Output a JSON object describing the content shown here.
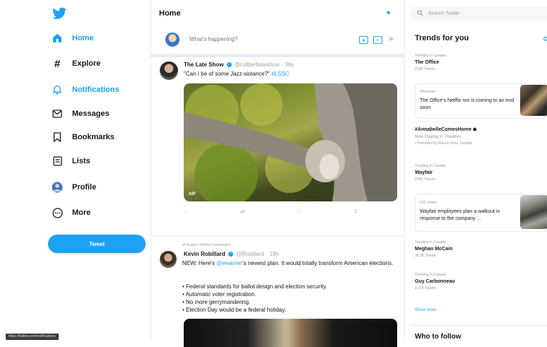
{
  "sidebar": {
    "items": [
      {
        "label": "Home"
      },
      {
        "label": "Explore"
      },
      {
        "label": "Notifications"
      },
      {
        "label": "Messages"
      },
      {
        "label": "Bookmarks"
      },
      {
        "label": "Lists"
      },
      {
        "label": "Profile"
      },
      {
        "label": "More"
      }
    ],
    "tweet_button": "Tweet",
    "status_url": "https://twitter.com/notifications"
  },
  "header": {
    "title": "Home"
  },
  "compose": {
    "placeholder": "What's happening?"
  },
  "tweets": [
    {
      "name": "The Late Show",
      "handle": "@colbertlateshow",
      "time": "36s",
      "text": "\"Can I be of some Jazz-sistance?\"",
      "hashtag": "#LSSC",
      "media_badge": "GIF"
    },
    {
      "retweeted_by": "Bradley Whitford Retweeted",
      "name": "Kevin Robillard",
      "handle": "@Robillard",
      "time": "13h",
      "text_prefix": "NEW: Here's",
      "mention": "@ewarren",
      "text_suffix": "'s newest plan. It would totally transform American elections.",
      "bullets": [
        "• Federal standards for ballot design and election security.",
        "• Automatic voter registration.",
        "• No more gerrymandering.",
        "• Election Day would be a federal holiday."
      ]
    }
  ],
  "search": {
    "placeholder": "Search Twitter"
  },
  "trends": {
    "title": "Trends for you",
    "items": [
      {
        "context": "Trending in Canada",
        "name": "The Office",
        "count": "219K Tweets"
      },
      {
        "context": "Television",
        "desc": "The Office's Netflix run is coming to an end soon"
      },
      {
        "name": "#AnnabelleComesHome",
        "count": "Now Playing In Theatres",
        "promoted": "Promoted by Warner Bros. Canada"
      },
      {
        "context": "Trending in Canada",
        "name": "Wayfair",
        "count": "239K Tweets"
      },
      {
        "context": "US news",
        "desc": "Wayfair employees plan a walkout in response to the company ..."
      },
      {
        "context": "Trending in Canada",
        "name": "Meghan McCain",
        "count": "38.3K Tweets"
      },
      {
        "context": "Trending in Canada",
        "name": "Guy Carbonneau",
        "count": "2,379 Tweets"
      }
    ],
    "show_more": "Show more"
  },
  "who_to_follow": {
    "title": "Who to follow"
  },
  "colors": {
    "accent": "#1da1f2",
    "text": "#14171a",
    "muted": "#657786"
  }
}
